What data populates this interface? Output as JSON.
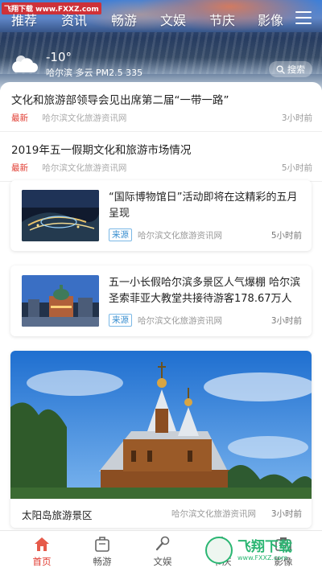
{
  "watermark": "飞翔下载 www.FXXZ.com",
  "nav": {
    "tabs": [
      "推荐",
      "资讯",
      "畅游",
      "文娱",
      "节庆",
      "影像"
    ]
  },
  "weather": {
    "temperature": "-10°",
    "info": "哈尔滨 多云 PM2.5 335"
  },
  "search": {
    "label": "搜索"
  },
  "feed": {
    "text_items": [
      {
        "title": "文化和旅游部领导会见出席第二届“一带一路”",
        "tag": "最新",
        "source": "哈尔滨文化旅游资讯网",
        "time": "3小时前"
      },
      {
        "title": "2019年五一假期文化和旅游市场情况",
        "tag": "最新",
        "source": "哈尔滨文化旅游资讯网",
        "time": "5小时前"
      }
    ],
    "image_items": [
      {
        "title": "“国际博物馆日”活动即将在这精彩的五月呈现",
        "source_tag": "来源",
        "source": "哈尔滨文化旅游资讯网",
        "time": "5小时前"
      },
      {
        "title": "五一小长假哈尔滨多景区人气爆棚 哈尔滨圣索菲亚大教堂共接待游客178.67万人",
        "source_tag": "来源",
        "source": "哈尔滨文化旅游资讯网",
        "time": "3小时前"
      }
    ],
    "feature": {
      "caption": "太阳岛旅游景区",
      "source": "哈尔滨文化旅游资讯网",
      "time": "3小时前"
    }
  },
  "bottom_nav": {
    "items": [
      {
        "label": "首页",
        "active": true
      },
      {
        "label": "畅游",
        "active": false
      },
      {
        "label": "文娱",
        "active": false
      },
      {
        "label": "节庆",
        "active": false
      },
      {
        "label": "影像",
        "active": false
      }
    ]
  },
  "app_badge": {
    "name": "飞翔下载",
    "url": "www.FXXZ.com"
  },
  "colors": {
    "accent": "#e03a2f",
    "source_blue": "#3a8fd0",
    "badge_green": "#2bb673"
  }
}
